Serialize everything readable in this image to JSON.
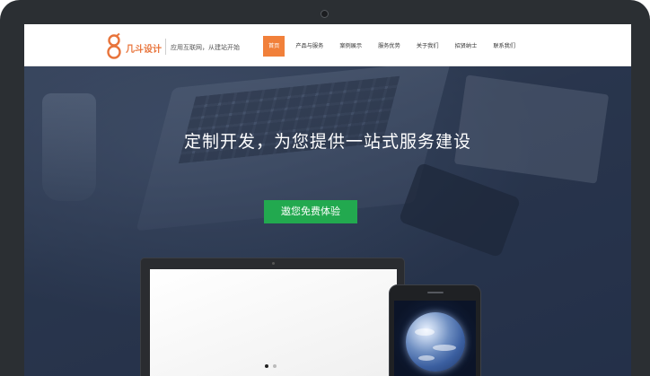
{
  "brand": {
    "logo_text": "几斗设计",
    "slogan": "应用互联网，从建站开始",
    "accent_color": "#f1803a"
  },
  "nav": {
    "items": [
      {
        "label": "首页",
        "active": true
      },
      {
        "label": "产品与服务",
        "active": false
      },
      {
        "label": "案例展示",
        "active": false
      },
      {
        "label": "服务优势",
        "active": false
      },
      {
        "label": "关于我们",
        "active": false
      },
      {
        "label": "招贤纳士",
        "active": false
      },
      {
        "label": "联系我们",
        "active": false
      }
    ]
  },
  "hero": {
    "title": "定制开发，为您提供一站式服务建设",
    "cta_label": "遨您免费体验",
    "cta_color": "#22a94f"
  },
  "carousel": {
    "slide_count": 2,
    "active_index": 0
  }
}
